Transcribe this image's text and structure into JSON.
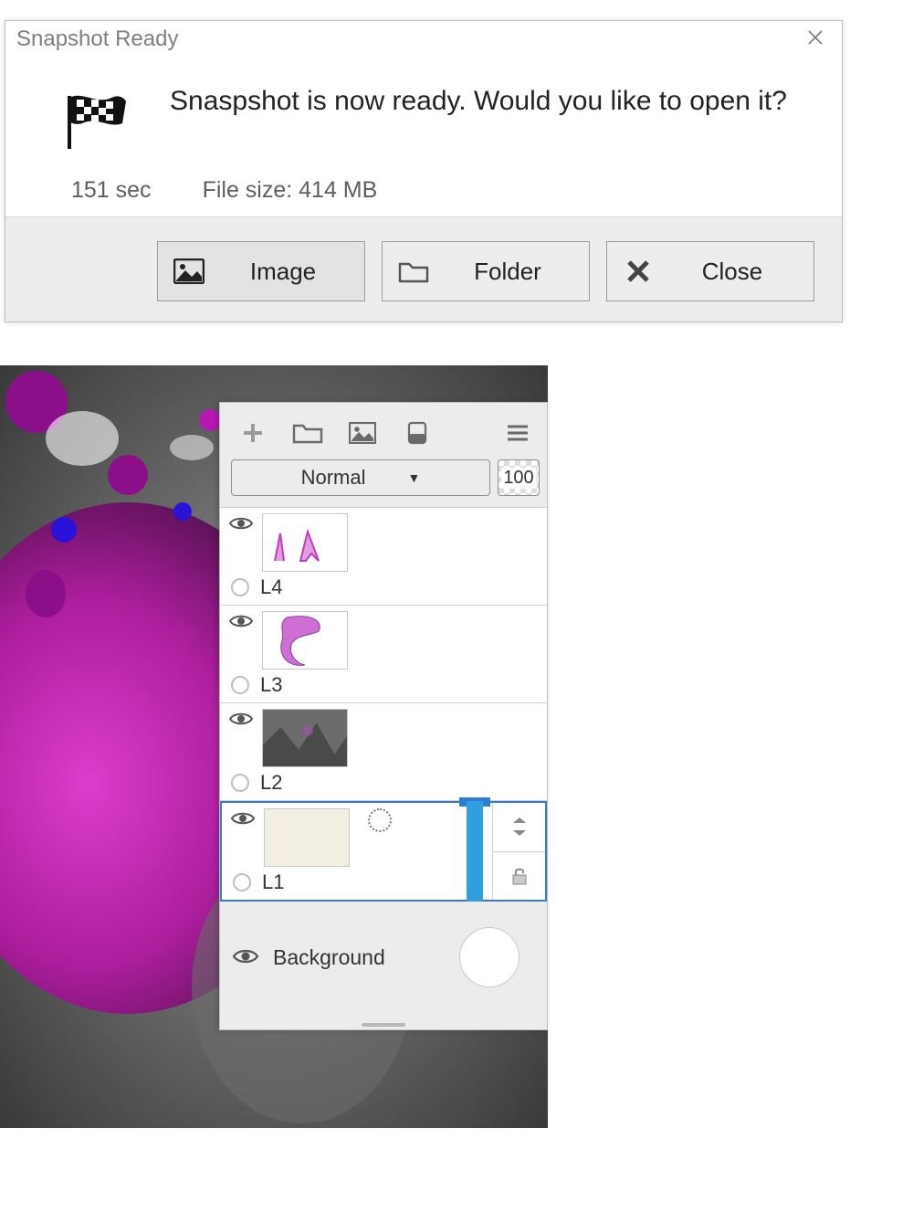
{
  "dialog": {
    "title": "Snapshot Ready",
    "message": "Snaspshot is now ready. Would you like to open it?",
    "elapsed": "151 sec",
    "filesize": "File size: 414 MB",
    "buttons": {
      "image": "Image",
      "folder": "Folder",
      "close": "Close"
    }
  },
  "layers": {
    "blend_mode": "Normal",
    "opacity": "100",
    "items": [
      {
        "name": "L4"
      },
      {
        "name": "L3"
      },
      {
        "name": "L2"
      },
      {
        "name": "L1"
      }
    ],
    "background_label": "Background"
  }
}
